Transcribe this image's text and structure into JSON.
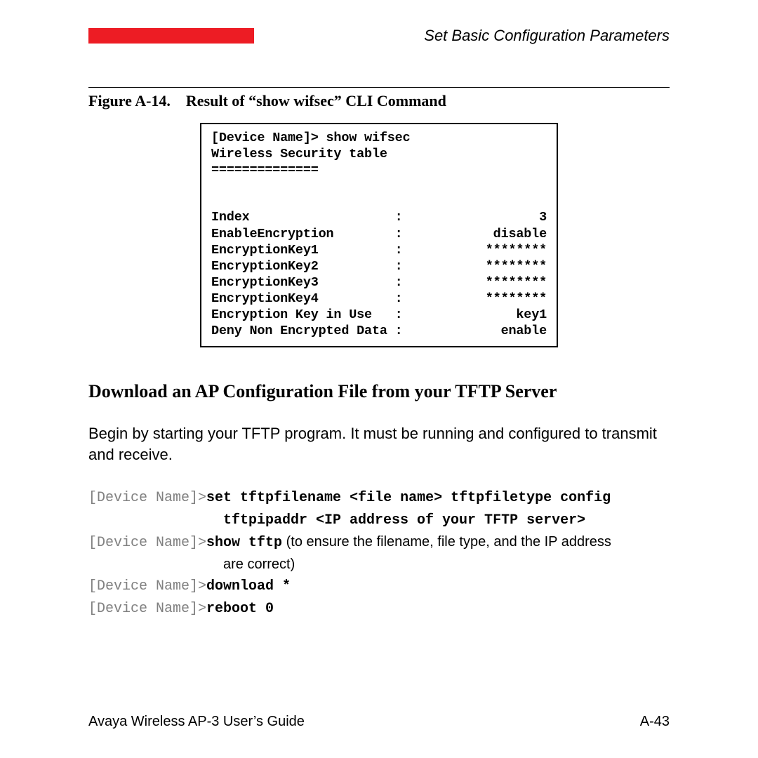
{
  "header": {
    "section": "Set Basic Configuration Parameters"
  },
  "figure": {
    "label": "Figure A-14.",
    "title": "Result of “show wifsec” CLI Command"
  },
  "cli": {
    "line1": "[Device Name]> show wifsec",
    "line2": "Wireless Security table",
    "line3": "==============",
    "rows": [
      {
        "k": "Index",
        "v": "3"
      },
      {
        "k": "EnableEncryption",
        "v": "disable"
      },
      {
        "k": "EncryptionKey1",
        "v": "********"
      },
      {
        "k": "EncryptionKey2",
        "v": "********"
      },
      {
        "k": "EncryptionKey3",
        "v": "********"
      },
      {
        "k": "EncryptionKey4",
        "v": "********"
      },
      {
        "k": "Encryption Key in Use",
        "v": "key1"
      },
      {
        "k": "Deny Non Encrypted Data",
        "v": "enable"
      }
    ],
    "colon": ":"
  },
  "section_heading": "Download an AP Configuration File from your TFTP Server",
  "body": "Begin by starting your TFTP program. It must be running and configured to transmit and receive.",
  "cmds": {
    "prompt": "[Device Name]>",
    "l1": "set tftpfilename <file name> tftpfiletype config",
    "l1b": "tftpipaddr <IP address of your TFTP server>",
    "l2a": "show tftp",
    "l2b": " (to ensure the filename, file type, and the IP address",
    "l2c": "are correct)",
    "l3": "download *",
    "l4": "reboot 0"
  },
  "footer": {
    "left": "Avaya Wireless AP-3 User’s Guide",
    "right": "A-43"
  }
}
